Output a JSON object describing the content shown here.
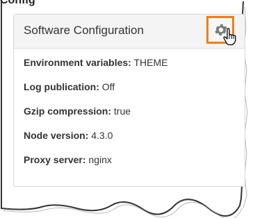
{
  "page": {
    "header_fragment": "Config"
  },
  "panel": {
    "title": "Software Configuration",
    "settings_icon": "gear-icon",
    "cursor_icon": "hand-pointer-icon",
    "accent_color": "#f07e14",
    "rows": [
      {
        "key": "Environment variables:",
        "value": "THEME"
      },
      {
        "key": "Log publication:",
        "value": "Off"
      },
      {
        "key": "Gzip compression:",
        "value": "true"
      },
      {
        "key": "Node version:",
        "value": "4.3.0"
      },
      {
        "key": "Proxy server:",
        "value": "nginx"
      }
    ]
  }
}
